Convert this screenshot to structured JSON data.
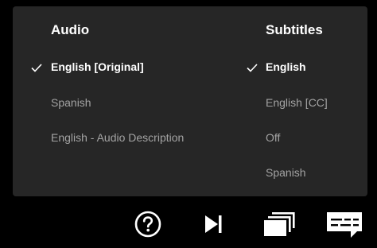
{
  "audio": {
    "title": "Audio",
    "options": [
      {
        "label": "English [Original]",
        "selected": true
      },
      {
        "label": "Spanish",
        "selected": false
      },
      {
        "label": "English - Audio Description",
        "selected": false
      }
    ]
  },
  "subtitles": {
    "title": "Subtitles",
    "options": [
      {
        "label": "English",
        "selected": true
      },
      {
        "label": "English [CC]",
        "selected": false
      },
      {
        "label": "Off",
        "selected": false
      },
      {
        "label": "Spanish",
        "selected": false
      }
    ]
  },
  "controls": [
    {
      "icon": "help-circle-icon"
    },
    {
      "icon": "next-episode-icon"
    },
    {
      "icon": "episodes-icon"
    },
    {
      "icon": "subtitles-audio-icon"
    }
  ],
  "colors": {
    "panel": "#262626",
    "selected_text": "#ffffff",
    "unselected_text": "#a3a3a3"
  }
}
